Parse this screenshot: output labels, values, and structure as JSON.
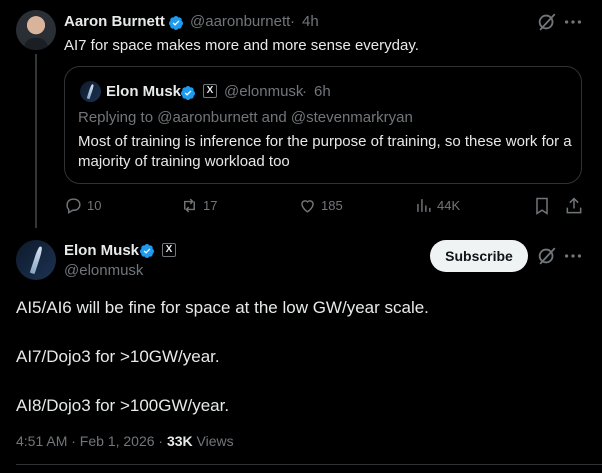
{
  "reply": {
    "name": "Aaron Burnett",
    "handle": "@aaronburnett",
    "time": "4h",
    "text": "AI7 for space makes more and more sense everyday."
  },
  "quoted": {
    "name": "Elon Musk",
    "handle": "@elonmusk",
    "time": "6h",
    "replying_prefix": "Replying to ",
    "replying_handle1": "@aaronburnett",
    "replying_and": " and ",
    "replying_handle2": "@stevenmarkryan",
    "text": "Most of training is inference for the purpose of training, so these work for a majority of training workload too"
  },
  "actions": {
    "replies": "10",
    "reposts": "17",
    "likes": "185",
    "views": "44K"
  },
  "main_post": {
    "name": "Elon Musk",
    "handle": "@elonmusk",
    "subscribe_label": "Subscribe",
    "line1": "AI5/AI6 will be fine for space at the low GW/year scale.",
    "line2": "AI7/Dojo3 for >10GW/year.",
    "line3": "AI8/Dojo3 for >100GW/year.",
    "timestamp": "4:51 AM · Feb 1, 2026 · ",
    "views_count": "33K",
    "views_label": " Views"
  },
  "colors": {
    "background": "#000000",
    "text": "#e7e9ea",
    "muted": "#71767b",
    "verified": "#1d9bf0",
    "border": "#2f3336"
  },
  "icons": [
    "verified-badge-icon",
    "x-logo-icon",
    "grok-icon",
    "more-icon",
    "reply-icon",
    "repost-icon",
    "like-icon",
    "views-icon",
    "bookmark-icon",
    "share-icon"
  ]
}
